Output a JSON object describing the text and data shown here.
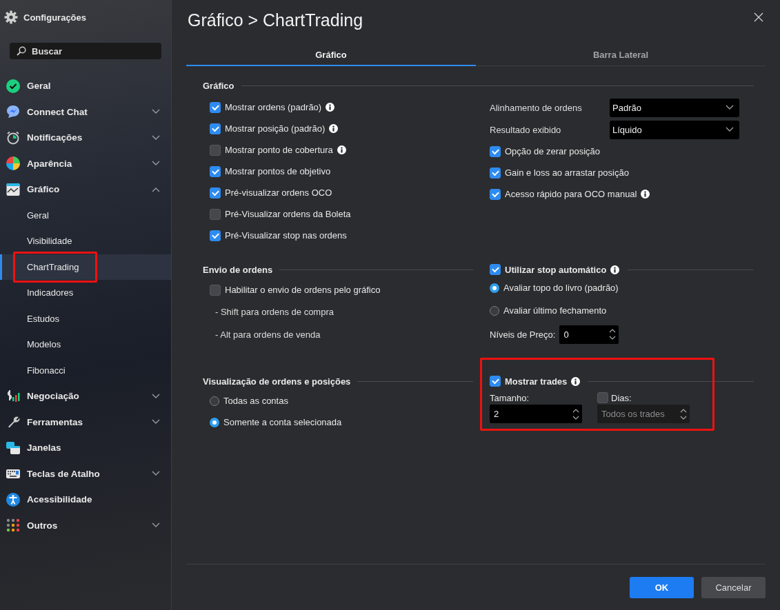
{
  "window": {
    "title": "Configurações"
  },
  "search": {
    "placeholder": "Buscar"
  },
  "sidebar": {
    "items": [
      {
        "label": "Geral"
      },
      {
        "label": "Connect Chat",
        "expanded": false
      },
      {
        "label": "Notificações",
        "expanded": false
      },
      {
        "label": "Aparência",
        "expanded": false
      },
      {
        "label": "Gráfico",
        "expanded": true,
        "children": [
          {
            "label": "Geral",
            "selected": false,
            "highlighted": false
          },
          {
            "label": "Visibilidade",
            "selected": false,
            "highlighted": false
          },
          {
            "label": "ChartTrading",
            "selected": true,
            "highlighted": true
          },
          {
            "label": "Indicadores",
            "selected": false,
            "highlighted": false
          },
          {
            "label": "Estudos",
            "selected": false,
            "highlighted": false
          },
          {
            "label": "Modelos",
            "selected": false,
            "highlighted": false
          },
          {
            "label": "Fibonacci",
            "selected": false,
            "highlighted": false
          }
        ]
      },
      {
        "label": "Negociação",
        "expanded": false
      },
      {
        "label": "Ferramentas",
        "expanded": false
      },
      {
        "label": "Janelas"
      },
      {
        "label": "Teclas de Atalho",
        "expanded": false
      },
      {
        "label": "Acessibilidade"
      },
      {
        "label": "Outros",
        "expanded": false
      }
    ]
  },
  "page": {
    "title": "Gráfico > ChartTrading"
  },
  "tabs": [
    {
      "label": "Gráfico",
      "selected": true
    },
    {
      "label": "Barra Lateral",
      "selected": false
    }
  ],
  "grafico": {
    "title": "Gráfico",
    "left_options": [
      {
        "label": "Mostrar ordens (padrão)",
        "checked": true,
        "info": true
      },
      {
        "label": "Mostrar posição (padrão)",
        "checked": true,
        "info": true
      },
      {
        "label": "Mostrar ponto de cobertura",
        "checked": false,
        "info": true
      },
      {
        "label": "Mostrar pontos de objetivo",
        "checked": true,
        "info": false
      },
      {
        "label": "Pré-visualizar ordens OCO",
        "checked": true,
        "info": false
      },
      {
        "label": "Pré-Visualizar ordens da Boleta",
        "checked": false,
        "info": false
      },
      {
        "label": "Pré-Visualizar stop nas ordens",
        "checked": true,
        "info": false
      }
    ],
    "selects": [
      {
        "label": "Alinhamento de ordens",
        "value": "Padrão"
      },
      {
        "label": "Resultado exibido",
        "value": "Líquido"
      }
    ],
    "right_options": [
      {
        "label": "Opção de zerar posição",
        "checked": true,
        "info": false
      },
      {
        "label": "Gain e loss ao arrastar posição",
        "checked": true,
        "info": false
      },
      {
        "label": "Acesso rápido para OCO manual",
        "checked": true,
        "info": true
      }
    ]
  },
  "envio": {
    "title": "Envio de ordens",
    "option": {
      "label": "Habilitar o envio de ordens pelo gráfico",
      "checked": false,
      "info": false
    },
    "notes": [
      "- Shift para ordens de compra",
      "- Alt para ordens de venda"
    ]
  },
  "stop": {
    "label": "Utilizar stop automático",
    "checked": true,
    "info": true,
    "radios": [
      {
        "label": "Avaliar topo do livro (padrão)",
        "selected": true
      },
      {
        "label": "Avaliar último fechamento",
        "selected": false
      }
    ],
    "levels": {
      "label": "Níveis de Preço:",
      "value": "0"
    }
  },
  "visualizacao": {
    "title": "Visualização de ordens e posições",
    "radios": [
      {
        "label": "Todas as contas",
        "selected": false
      },
      {
        "label": "Somente a conta selecionada",
        "selected": true
      }
    ]
  },
  "trades": {
    "label": "Mostrar trades",
    "checked": true,
    "info": true,
    "highlighted": true,
    "size": {
      "label": "Tamanho:",
      "value": "2"
    },
    "days": {
      "label": "Dias:",
      "checked": false,
      "value": "Todos os trades",
      "disabled": true
    }
  },
  "buttons": [
    {
      "label": "OK",
      "kind": "primary"
    },
    {
      "label": "Cancelar",
      "kind": "secondary"
    }
  ]
}
